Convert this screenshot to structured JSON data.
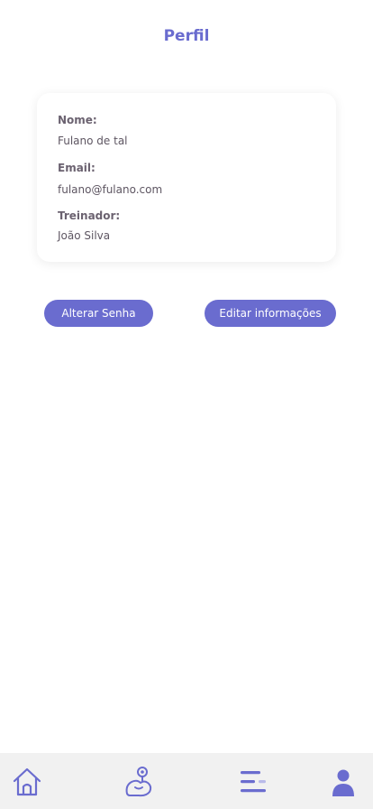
{
  "header": {
    "title": "Perfil"
  },
  "profile": {
    "name_label": "Nome:",
    "name_value": "Fulano de tal",
    "email_label": "Email:",
    "email_value": "fulano@fulano.com",
    "trainer_label": "Treinador:",
    "trainer_value": "João Silva"
  },
  "actions": {
    "change_password": "Alterar Senha",
    "edit_info": "Editar informações"
  },
  "tabbar": {
    "items": [
      {
        "icon": "home-icon",
        "active": false
      },
      {
        "icon": "workout-icon",
        "active": false
      },
      {
        "icon": "menu-icon",
        "active": false
      },
      {
        "icon": "profile-icon",
        "active": true
      }
    ]
  },
  "colors": {
    "accent": "#6a6ccf",
    "background": "#ffffff",
    "tabbar": "#f1f1f1"
  }
}
